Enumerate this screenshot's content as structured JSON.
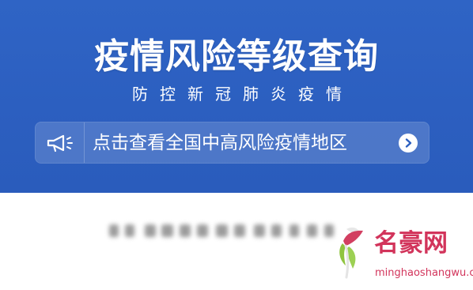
{
  "header": {
    "title": "疫情风险等级查询",
    "subtitle": "防控新冠肺炎疫情"
  },
  "notice": {
    "text": "点击查看全国中高风险疫情地区",
    "icon": "megaphone-icon",
    "arrow_icon": "chevron-right-icon"
  },
  "watermark": {
    "name": "名豪网",
    "url": "minghaoshangwu.com"
  },
  "colors": {
    "header_bg": "#2c5fc0",
    "text_primary": "#ffffff",
    "watermark": "#d2345b"
  }
}
